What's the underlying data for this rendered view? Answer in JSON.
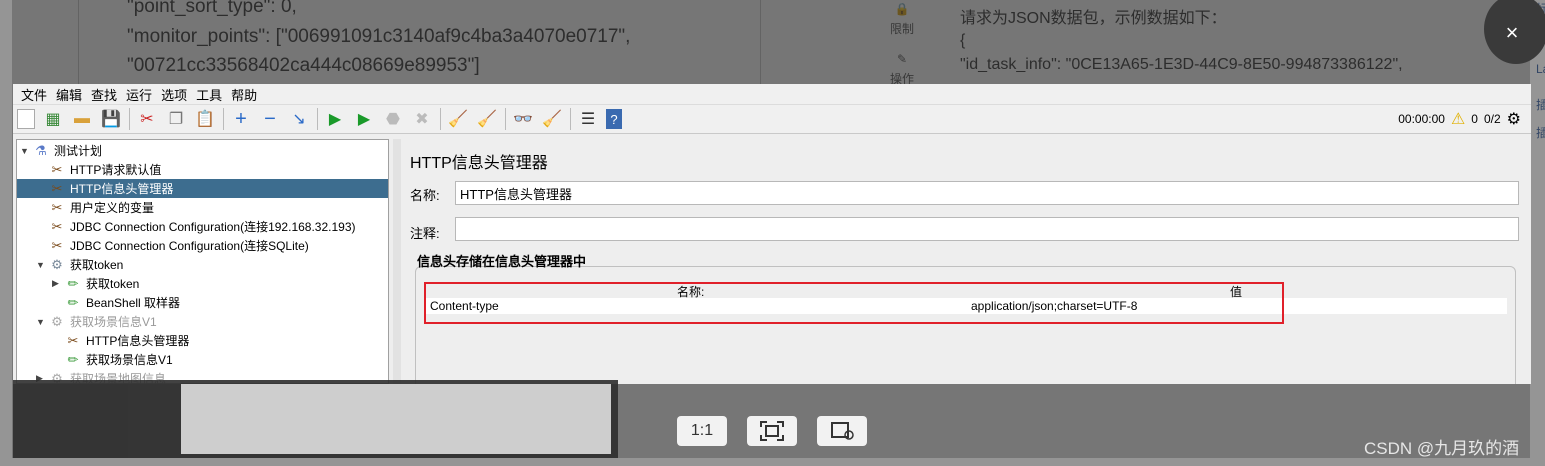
{
  "background": {
    "json_lines": [
      "\"point_sort_type\": 0,",
      "\"monitor_points\": [\"006991091c3140af9c4ba3a4070e0717\",",
      "\"00721cc33568402ca444c08669e89953\"]"
    ],
    "side_buttons": [
      "限制",
      "操作"
    ],
    "right_lines": [
      "请求为JSON数据包，示例数据如下：",
      "{",
      "\"id_task_info\": \"0CE13A65-1E3D-44C9-8E50-994873386122\","
    ],
    "edge_labels": [
      "标",
      "代",
      "La",
      "插",
      "插"
    ]
  },
  "jmeter": {
    "menu": [
      "文件",
      "编辑",
      "查找",
      "运行",
      "选项",
      "工具",
      "帮助"
    ],
    "toolbar_icons": [
      "new-icon",
      "templates-icon",
      "open-icon",
      "save-icon",
      "cut-icon",
      "copy-icon",
      "paste-icon",
      "expand-icon",
      "collapse-icon",
      "toggle-icon",
      "start-icon",
      "start-no-pause-icon",
      "stop-icon",
      "shutdown-icon",
      "clear-icon",
      "clear-all-icon",
      "search-icon",
      "reset-search-icon",
      "function-helper-icon",
      "help-icon"
    ],
    "status": {
      "timer": "00:00:00",
      "warnings": "0",
      "threads": "0/2"
    },
    "tree": [
      {
        "label": "测试计划",
        "indent": 0,
        "toggle": "▼",
        "icon": "test-plan-icon"
      },
      {
        "label": "HTTP请求默认值",
        "indent": 1,
        "toggle": "",
        "icon": "config-icon"
      },
      {
        "label": "HTTP信息头管理器",
        "indent": 1,
        "toggle": "",
        "icon": "config-icon",
        "selected": true
      },
      {
        "label": "用户定义的变量",
        "indent": 1,
        "toggle": "",
        "icon": "config-icon"
      },
      {
        "label": "JDBC Connection Configuration(连接192.168.32.193)",
        "indent": 1,
        "toggle": "",
        "icon": "config-icon"
      },
      {
        "label": "JDBC Connection Configuration(连接SQLite)",
        "indent": 1,
        "toggle": "",
        "icon": "config-icon"
      },
      {
        "label": "获取token",
        "indent": 1,
        "toggle": "▼",
        "icon": "thread-group-icon"
      },
      {
        "label": "获取token",
        "indent": 2,
        "toggle": "▶",
        "icon": "sampler-icon"
      },
      {
        "label": "BeanShell 取样器",
        "indent": 2,
        "toggle": "",
        "icon": "sampler-icon"
      },
      {
        "label": "获取场景信息V1",
        "indent": 1,
        "toggle": "▼",
        "icon": "thread-group-icon",
        "disabled": true
      },
      {
        "label": "HTTP信息头管理器",
        "indent": 2,
        "toggle": "",
        "icon": "config-icon"
      },
      {
        "label": "获取场景信息V1",
        "indent": 2,
        "toggle": "",
        "icon": "sampler-icon"
      },
      {
        "label": "获取场景地图信息",
        "indent": 1,
        "toggle": "▶",
        "icon": "thread-group-icon",
        "disabled": true
      }
    ],
    "panel": {
      "title": "HTTP信息头管理器",
      "name_label": "名称:",
      "name_value": "HTTP信息头管理器",
      "comment_label": "注释:",
      "comment_value": "",
      "group_title": "信息头存储在信息头管理器中",
      "columns": [
        "名称:",
        "值"
      ],
      "rows": [
        {
          "name": "Content-type",
          "value": "application/json;charset=UTF-8"
        }
      ]
    }
  },
  "viewer": {
    "buttons": [
      "1:1",
      "fit-screen-icon",
      "save-image-icon"
    ],
    "close": "×",
    "watermark": "CSDN @九月玖的酒"
  },
  "colors": {
    "selection": "#3d6d8f",
    "highlight": "#e0202a"
  }
}
